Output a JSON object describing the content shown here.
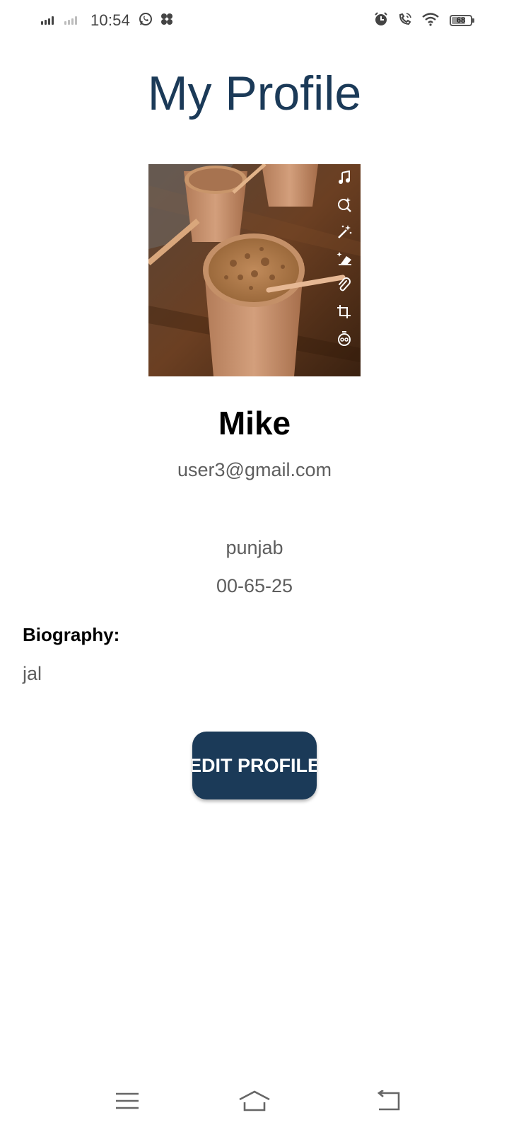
{
  "status_bar": {
    "time": "10:54",
    "battery_level": "68",
    "icons": [
      "signal-icon",
      "signal-2-icon",
      "whatsapp-icon",
      "pinwheel-icon",
      "alarm-icon",
      "wifi-calling-icon",
      "wifi-icon",
      "battery-icon"
    ]
  },
  "page": {
    "title": "My Profile"
  },
  "profile": {
    "name": "Mike",
    "email": "user3@gmail.com",
    "location": "punjab",
    "dob": "00-65-25",
    "bio_label": "Biography:",
    "bio": "jal"
  },
  "photo_tools": [
    "music-note-icon",
    "search-sparkle-icon",
    "magic-wand-icon",
    "eraser-icon",
    "paperclip-icon",
    "crop-icon",
    "timer-icon"
  ],
  "actions": {
    "edit_label": "EDIT PROFILE"
  },
  "nav": {
    "items": [
      "menu-icon",
      "home-icon",
      "back-icon"
    ]
  },
  "colors": {
    "primary": "#1b3a58",
    "text_secondary": "#5e5e5e",
    "background": "#ffffff"
  }
}
